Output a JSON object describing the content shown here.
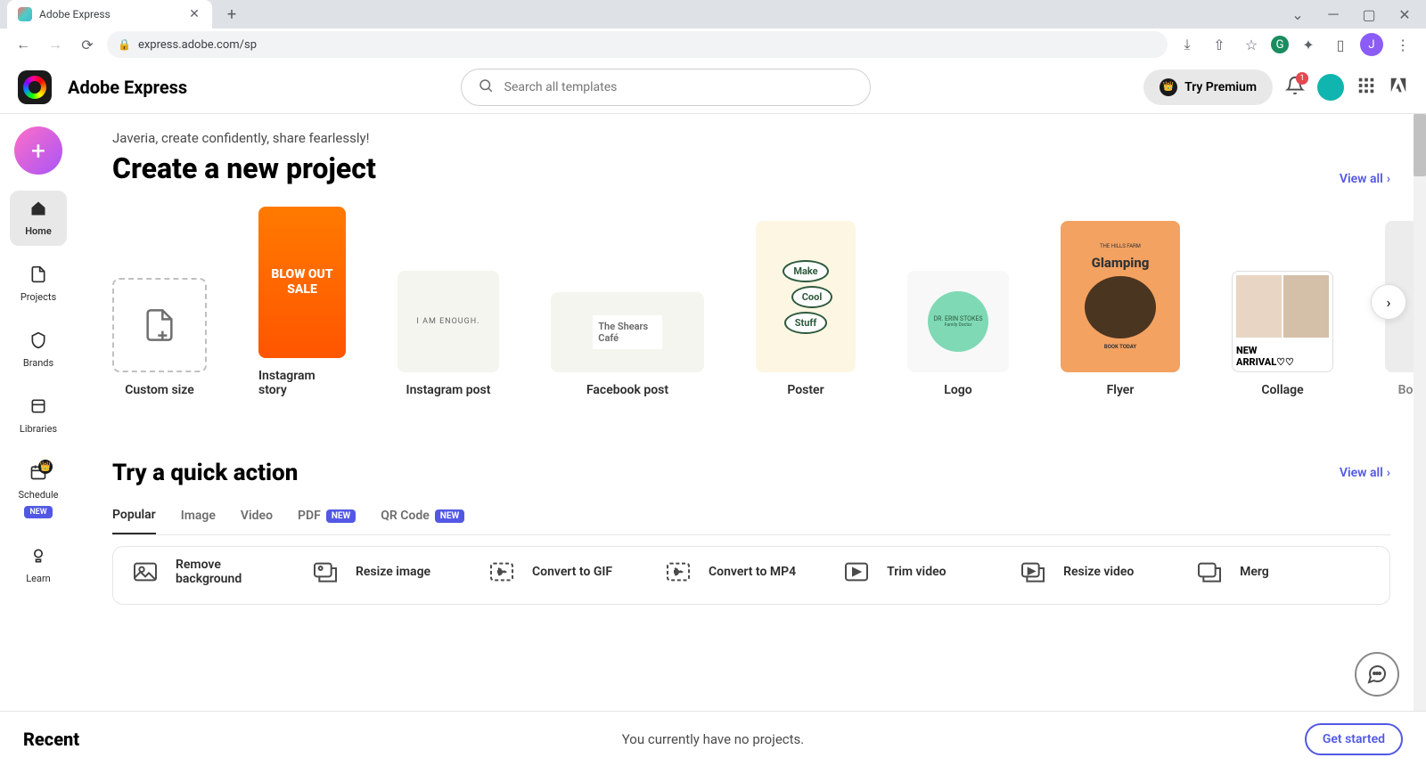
{
  "browser": {
    "tab_title": "Adobe Express",
    "url": "express.adobe.com/sp",
    "avatar_letter": "J"
  },
  "header": {
    "app_name": "Adobe Express",
    "search_placeholder": "Search all templates",
    "try_premium": "Try Premium",
    "notif_count": "1"
  },
  "sidebar": {
    "items": [
      {
        "label": "Home",
        "icon": "🏠"
      },
      {
        "label": "Projects",
        "icon": "▢"
      },
      {
        "label": "Brands",
        "icon": "⛊"
      },
      {
        "label": "Libraries",
        "icon": "▭"
      },
      {
        "label": "Schedule",
        "icon": "📅",
        "badge": "NEW"
      },
      {
        "label": "Learn",
        "icon": "💡"
      }
    ]
  },
  "main": {
    "greeting": "Javeria, create confidently, share fearlessly!",
    "section_title": "Create a new project",
    "view_all": "View all",
    "cards": [
      {
        "label": "Custom size"
      },
      {
        "label": "Instagram story",
        "thumb_text": "BLOW OUT SALE"
      },
      {
        "label": "Instagram post",
        "thumb_text": "I AM ENOUGH."
      },
      {
        "label": "Facebook post",
        "thumb_text": "The Shears Café"
      },
      {
        "label": "Poster",
        "thumb_text": "Make Cool Stuff"
      },
      {
        "label": "Logo",
        "thumb_text": "DR. ERIN STOKES"
      },
      {
        "label": "Flyer",
        "thumb_text": "Glamping"
      },
      {
        "label": "Collage",
        "thumb_text": "New Arrival"
      },
      {
        "label": "Book co"
      }
    ]
  },
  "quickActions": {
    "title": "Try a quick action",
    "view_all": "View all",
    "tabs": [
      {
        "label": "Popular",
        "active": true
      },
      {
        "label": "Image"
      },
      {
        "label": "Video"
      },
      {
        "label": "PDF",
        "badge": "NEW"
      },
      {
        "label": "QR Code",
        "badge": "NEW"
      }
    ],
    "actions": [
      {
        "label": "Remove background"
      },
      {
        "label": "Resize image"
      },
      {
        "label": "Convert to GIF"
      },
      {
        "label": "Convert to MP4"
      },
      {
        "label": "Trim video"
      },
      {
        "label": "Resize video"
      },
      {
        "label": "Merg"
      }
    ]
  },
  "footer": {
    "title": "Recent",
    "message": "You currently have no projects.",
    "button": "Get started"
  }
}
